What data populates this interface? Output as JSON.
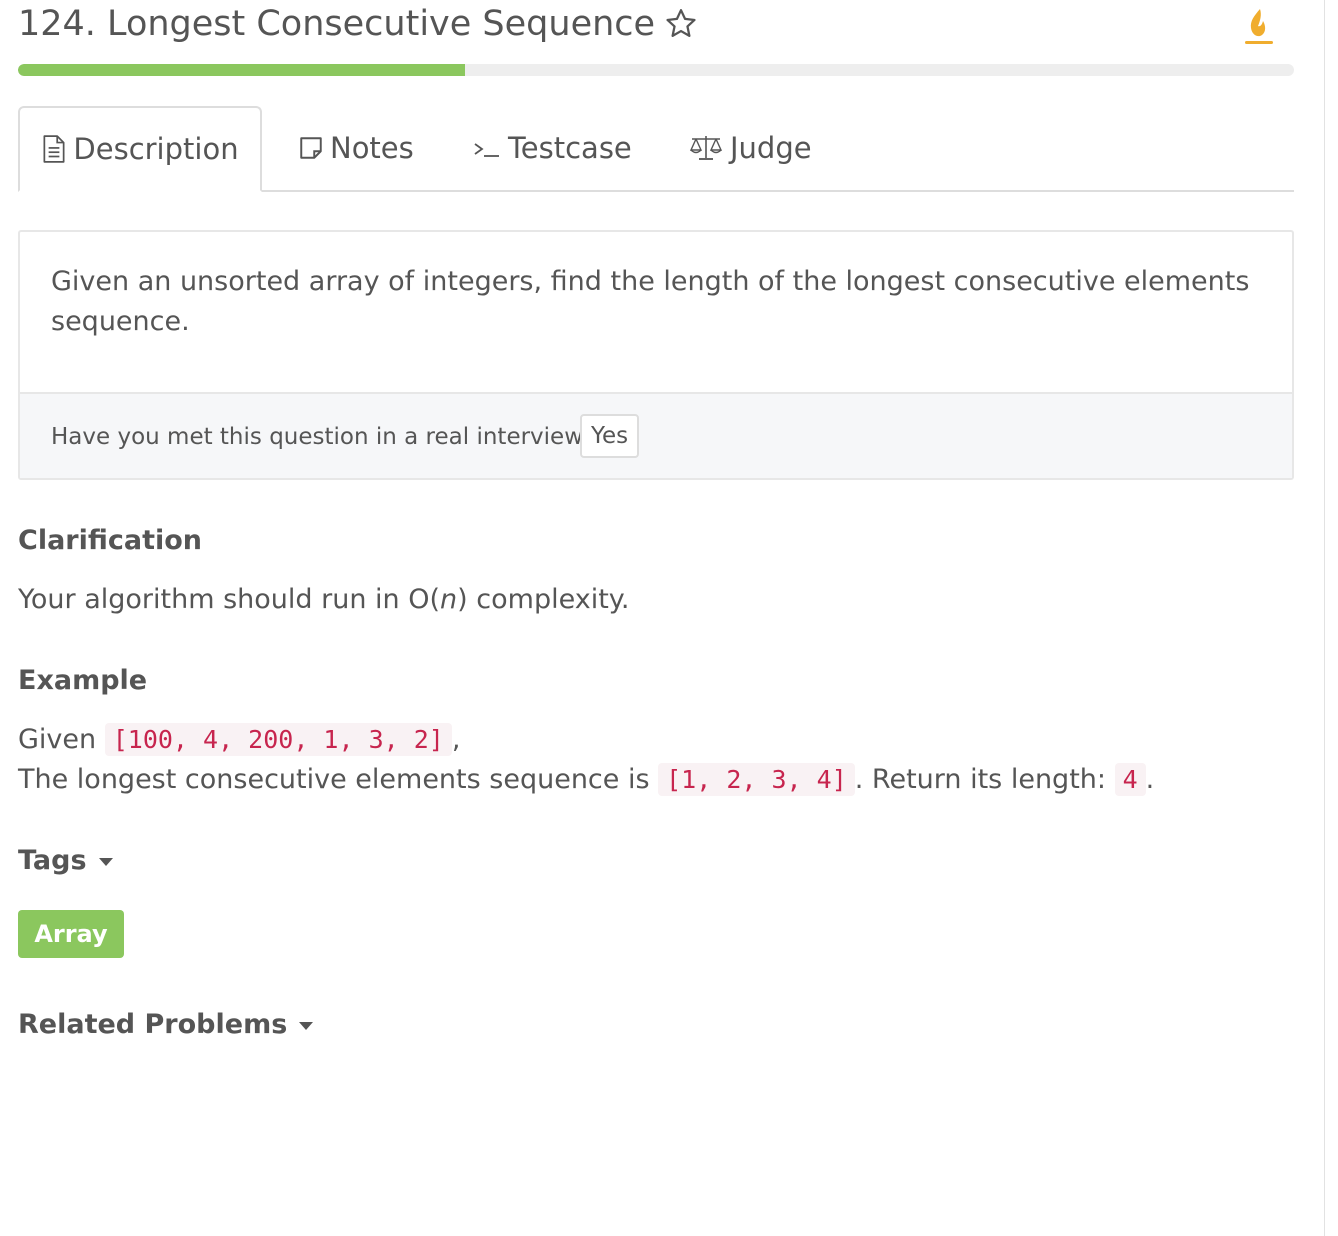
{
  "header": {
    "title": "124. Longest Consecutive Sequence",
    "star_icon": "star-outline-icon",
    "flame_icon": "flame-icon",
    "flame_color": "#f0ad2e"
  },
  "progress": {
    "percent": 35,
    "color": "#8bc75e"
  },
  "tabs": [
    {
      "label": "Description",
      "icon": "file-text-icon",
      "active": true
    },
    {
      "label": "Notes",
      "icon": "note-icon",
      "active": false
    },
    {
      "label": "Testcase",
      "icon": "terminal-icon",
      "active": false
    },
    {
      "label": "Judge",
      "icon": "scale-icon",
      "active": false
    }
  ],
  "description": {
    "text": "Given an unsorted array of integers, find the length of the longest consecutive elements sequence."
  },
  "interview": {
    "question": "Have you met this question in a real interview?",
    "yes_label": "Yes"
  },
  "clarification": {
    "title": "Clarification",
    "text_before": "Your algorithm should run in O(",
    "text_italic": "n",
    "text_after": ") complexity."
  },
  "example": {
    "title": "Example",
    "line1_prefix": "Given ",
    "line1_code": "[100, 4, 200, 1, 3, 2]",
    "line1_suffix": ",",
    "line2_prefix": "The longest consecutive elements sequence is ",
    "line2_code": "[1, 2, 3, 4]",
    "line2_middle": ". Return its length: ",
    "line2_code2": "4",
    "line2_suffix": "."
  },
  "tags": {
    "title": "Tags",
    "items": [
      "Array"
    ],
    "color": "#8bc75e"
  },
  "related": {
    "title": "Related Problems"
  }
}
